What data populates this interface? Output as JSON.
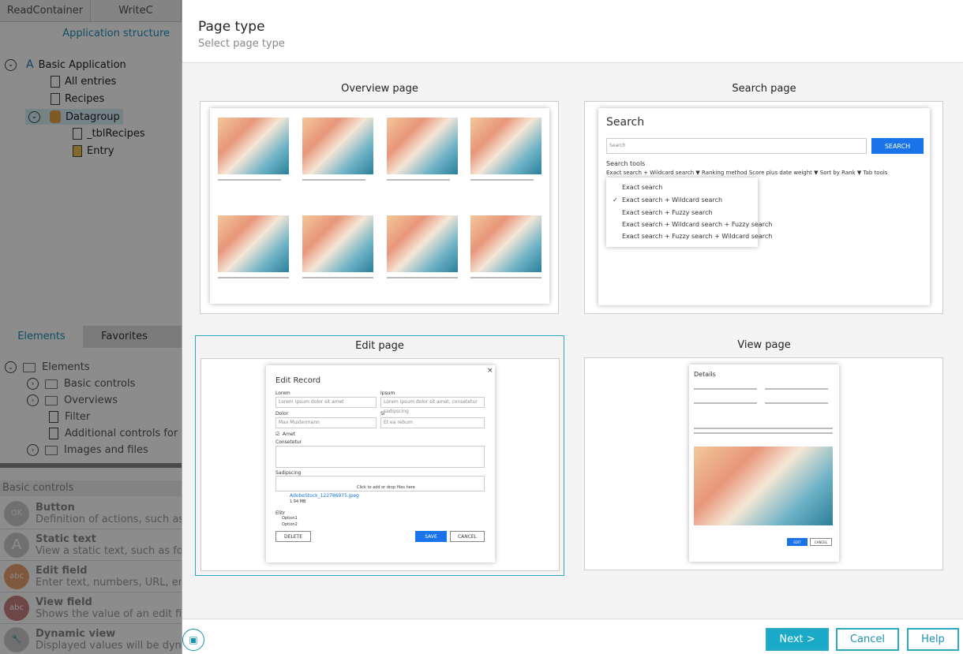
{
  "left": {
    "tabs": [
      "ReadContainer",
      "WriteC"
    ],
    "app_structure_label": "Application structure",
    "tree": [
      {
        "label": "Basic Application"
      },
      {
        "label": "All entries"
      },
      {
        "label": "Recipes"
      },
      {
        "label": "Datagroup"
      },
      {
        "label": "_tblRecipes"
      },
      {
        "label": "Entry"
      }
    ],
    "element_tabs": [
      "Elements",
      "Favorites"
    ],
    "elements": [
      "Elements",
      "Basic controls",
      "Overviews",
      "Filter",
      "Additional controls for",
      "Images and files"
    ],
    "basic_controls_header": "Basic controls",
    "controls": [
      {
        "icon": "OK",
        "title": "Button",
        "desc": "Definition of actions, such as"
      },
      {
        "icon": "A",
        "title": "Static text",
        "desc": "View a static text, such as for"
      },
      {
        "icon": "abc",
        "title": "Edit field",
        "desc": "Enter text, numbers, URL, em"
      },
      {
        "icon": "abc",
        "title": "View field",
        "desc": "Shows the value of an edit fie"
      },
      {
        "icon": "wrench",
        "title": "Dynamic view",
        "desc": "Displayed values will be dyna"
      }
    ]
  },
  "dialog": {
    "title": "Page type",
    "subtitle": "Select page type",
    "cards": {
      "overview": "Overview page",
      "search": "Search page",
      "edit": "Edit page",
      "view": "View page"
    },
    "search_preview": {
      "heading": "Search",
      "placeholder": "Search",
      "button": "SEARCH",
      "tools_label": "Search tools",
      "filters": "Exact search + Wildcard search ▼   Ranking method Score plus date weight ▼   Sort by Rank ▼   Tab tools",
      "options": [
        "Exact search",
        "Exact search + Wildcard search",
        "Exact search + Fuzzy search",
        "Exact search + Wildcard search + Fuzzy search",
        "Exact search + Fuzzy search + Wildcard search"
      ]
    },
    "edit_preview": {
      "heading": "Edit Record",
      "labels": [
        "Lorem",
        "Ipsum",
        "Dolor",
        "Si",
        "Consetetur",
        "Sadipscing",
        "Elitr"
      ],
      "values": [
        "Lorem ipsum dolor sit amet",
        "Lorem ipsum dolor sit amet, consetetur sadipscing",
        "Max Mustermann",
        "Et ea rebum"
      ],
      "checkbox": "Amet",
      "file": "AdobeStock_122786975.jpeg",
      "file_size": "1.94 MB",
      "upload_hint": "Click to add or drop files here",
      "options": [
        "Option1",
        "Option2"
      ],
      "delete": "DELETE",
      "save": "SAVE",
      "cancel": "CANCEL"
    },
    "view_preview": {
      "heading": "Details",
      "ok": "EDIT",
      "cancel": "CANCEL"
    },
    "footer": {
      "next": "Next >",
      "cancel": "Cancel",
      "help": "Help"
    }
  }
}
